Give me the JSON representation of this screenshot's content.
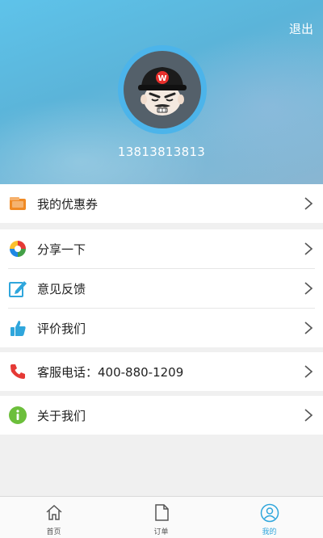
{
  "header": {
    "logout_label": "退出",
    "phone": "13813813813",
    "avatar_letter": "W"
  },
  "menu": {
    "coupons": "我的优惠券",
    "share": "分享一下",
    "feedback": "意见反馈",
    "rate": "评价我们",
    "service_phone": "客服电话：400-880-1209",
    "about": "关于我们"
  },
  "tabbar": {
    "items": [
      {
        "label": "首页",
        "icon": "home-icon",
        "active": false
      },
      {
        "label": "订单",
        "icon": "document-icon",
        "active": false
      },
      {
        "label": "我的",
        "icon": "user-icon",
        "active": true
      }
    ]
  },
  "colors": {
    "accent": "#2fa6dc",
    "header_gradient_start": "#5ec3ea",
    "coupon_icon": "#f08a24",
    "phone_icon": "#e53935",
    "about_icon": "#6cbf3b"
  }
}
